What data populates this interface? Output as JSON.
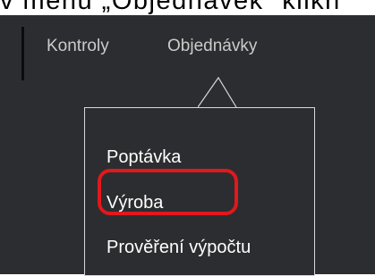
{
  "caption": {
    "text": "v menu „Objednávek“ klikn"
  },
  "nav": {
    "items": [
      {
        "label": "Kontroly"
      },
      {
        "label": "Objednávky"
      }
    ]
  },
  "dropdown": {
    "items": [
      {
        "label": "Poptávka"
      },
      {
        "label": "Výroba",
        "highlighted": true
      },
      {
        "label": "Prověření výpočtu"
      }
    ]
  },
  "colors": {
    "background": "#2c2d30",
    "text_primary": "#ffffff",
    "text_muted": "#cbcbcb",
    "dropdown_border": "#d8d8d8",
    "highlight": "#e1181c"
  }
}
